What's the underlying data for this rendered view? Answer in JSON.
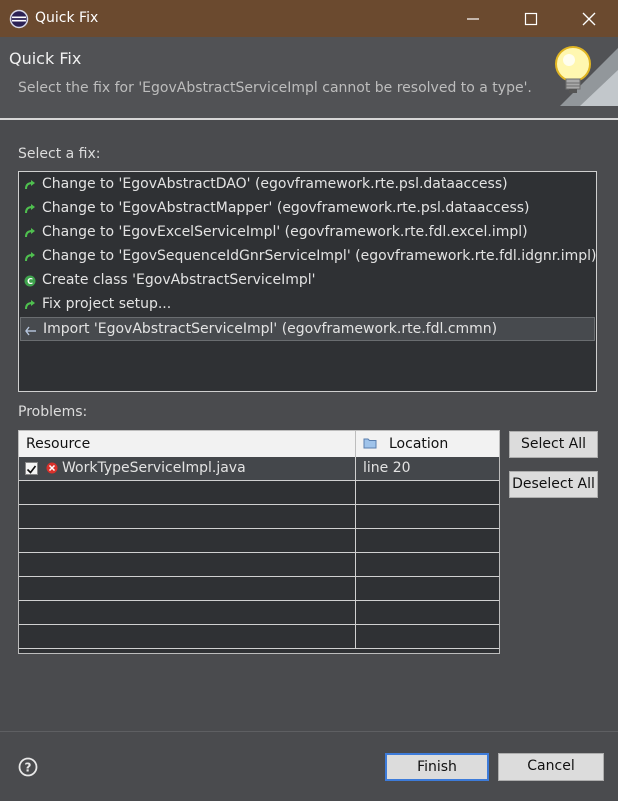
{
  "window": {
    "title": "Quick Fix",
    "app_icon": "eclipse-icon",
    "controls": [
      "minimize-icon",
      "maximize-icon",
      "close-icon"
    ]
  },
  "header": {
    "title": "Quick Fix",
    "message": "Select the fix for 'EgovAbstractServiceImpl cannot be resolved to a type'.",
    "icon": "lightbulb-icon"
  },
  "fixes": {
    "label": "Select a fix:",
    "items": [
      {
        "icon": "change-arrow-icon",
        "label": "Change to 'EgovAbstractDAO' (egovframework.rte.psl.dataaccess)"
      },
      {
        "icon": "change-arrow-icon",
        "label": "Change to 'EgovAbstractMapper' (egovframework.rte.psl.dataaccess)"
      },
      {
        "icon": "change-arrow-icon",
        "label": "Change to 'EgovExcelServiceImpl' (egovframework.rte.fdl.excel.impl)"
      },
      {
        "icon": "change-arrow-icon",
        "label": "Change to 'EgovSequenceIdGnrServiceImpl' (egovframework.rte.fdl.idgnr.impl)"
      },
      {
        "icon": "create-class-icon",
        "label": "Create class 'EgovAbstractServiceImpl'"
      },
      {
        "icon": "change-arrow-icon",
        "label": "Fix project setup..."
      },
      {
        "icon": "import-icon",
        "label": "Import 'EgovAbstractServiceImpl' (egovframework.rte.fdl.cmmn)",
        "selected": true
      }
    ]
  },
  "problems": {
    "label": "Problems:",
    "columns": {
      "resource": "Resource",
      "location": "Location"
    },
    "rows": [
      {
        "checked": true,
        "resource": "WorkTypeServiceImpl.java",
        "location": "line 20"
      }
    ],
    "select_all": "Select All",
    "deselect_all": "Deselect All"
  },
  "footer": {
    "help_icon": "help-icon",
    "finish": "Finish",
    "cancel": "Cancel"
  },
  "colors": {
    "titlebar": "#6b4a2f",
    "background": "#4a4b4e",
    "list_bg": "#2f3134",
    "primary_border": "#3d7bd9"
  }
}
